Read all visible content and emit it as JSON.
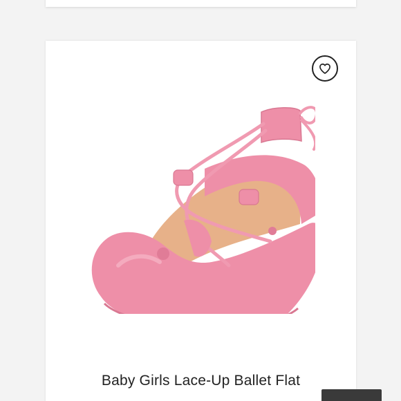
{
  "product": {
    "title": "Baby Girls Lace-Up Ballet Flat",
    "image_subject": "pink lace-up ballet flat shoe"
  },
  "favorite_button": {
    "icon": "heart-icon"
  },
  "colors": {
    "shoe_pink": "#ee8fa8",
    "shoe_inner": "#e8b48c",
    "background": "#f3f3f3",
    "card": "#ffffff"
  }
}
